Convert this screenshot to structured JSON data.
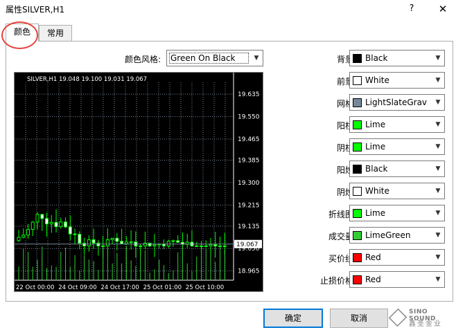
{
  "window": {
    "title": "属性SILVER,H1",
    "help_label": "?",
    "close_label": "✕"
  },
  "tabs": [
    {
      "label": "颜色",
      "active": true
    },
    {
      "label": "常用",
      "active": false
    }
  ],
  "color_scheme": {
    "label": "颜色风格:",
    "value": "Green On Black"
  },
  "chart_preview": {
    "header": "SILVER,H1  19.048 19.100 19.031 19.067",
    "price_labels": [
      "19.635",
      "19.550",
      "19.465",
      "19.385",
      "19.300",
      "19.215",
      "19.135",
      "19.050",
      "18.965"
    ],
    "current_price": "19.067",
    "time_labels": [
      "22 Oct 00:00",
      "24 Oct 09:00",
      "24 Oct 17:00",
      "25 Oct 01:00",
      "25 Oct 10:00"
    ],
    "background_color": "#000000",
    "foreground_color": "#ffffff",
    "grid_color": "#778899",
    "bull_color": "#00ff00",
    "bear_color": "#00ff00",
    "bull_candle_fill": "#000000",
    "bear_candle_fill": "#ffffff",
    "volume_color": "#32cd32"
  },
  "properties": [
    {
      "label": "背景:",
      "value": "Black",
      "color": "#000000"
    },
    {
      "label": "前景:",
      "value": "White",
      "color": "#ffffff"
    },
    {
      "label": "网格:",
      "value": "LightSlateGrav",
      "color": "#778899"
    },
    {
      "label": "阳柱:",
      "value": "Lime",
      "color": "#00ff00"
    },
    {
      "label": "阴柱:",
      "value": "Lime",
      "color": "#00ff00"
    },
    {
      "label": "阳烛:",
      "value": "Black",
      "color": "#000000"
    },
    {
      "label": "阴烛:",
      "value": "White",
      "color": "#ffffff"
    },
    {
      "label": "折线图:",
      "value": "Lime",
      "color": "#00ff00"
    },
    {
      "label": "成交量:",
      "value": "LimeGreen",
      "color": "#32cd32"
    },
    {
      "label": "买价线:",
      "value": "Red",
      "color": "#ff0000"
    },
    {
      "label": "止损价格:",
      "value": "Red",
      "color": "#ff0000"
    }
  ],
  "buttons": {
    "ok": "确定",
    "cancel": "取消"
  },
  "watermark": {
    "line1": "SINO SOUND",
    "line2": "鑫圣金业"
  }
}
